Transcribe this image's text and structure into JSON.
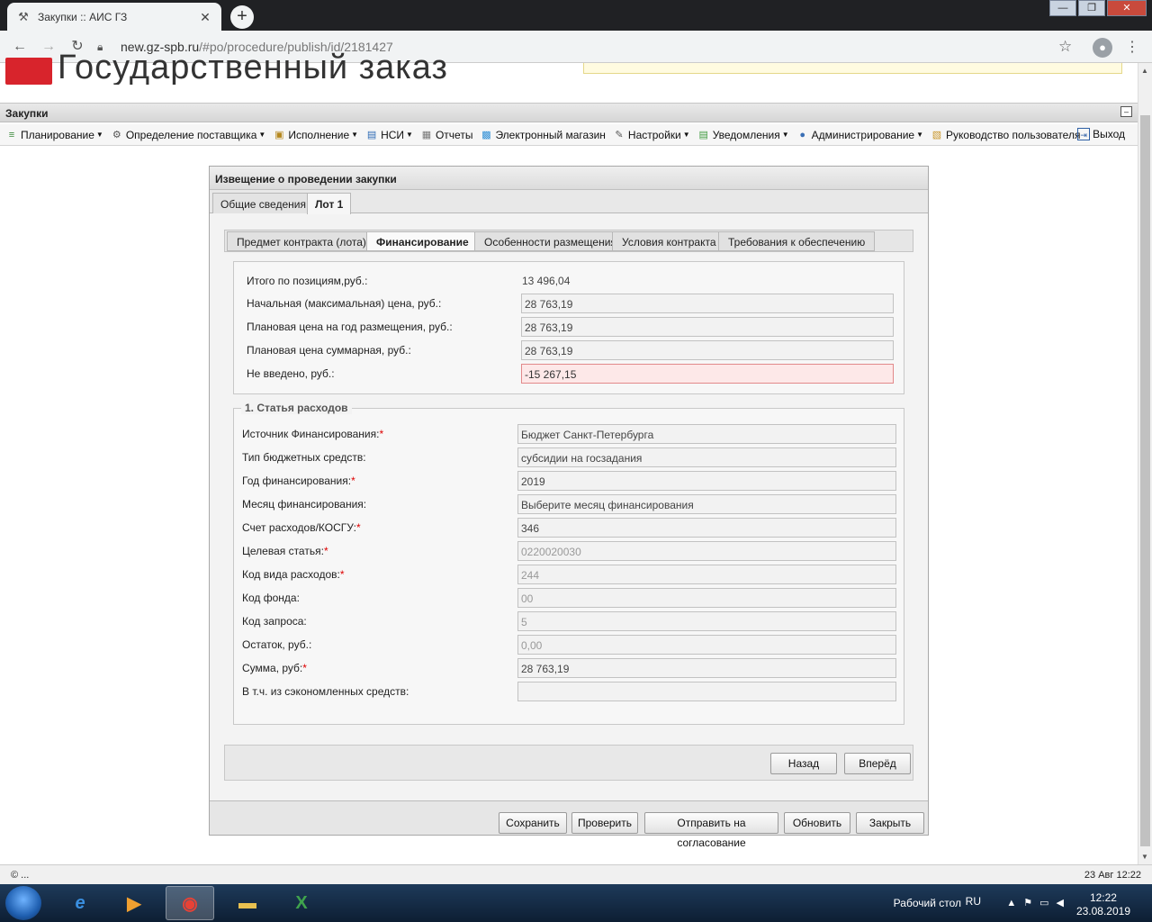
{
  "browser": {
    "tab_title": "Закупки :: АИС ГЗ",
    "tab_close": "✕",
    "newtab": "+",
    "win_min": "—",
    "win_max": "❐",
    "win_close": "✕",
    "url_host": "new.gz-spb.ru",
    "url_path": "/#po/procedure/publish/id/2181427"
  },
  "site": {
    "logo_text": "Государственный заказ"
  },
  "app": {
    "title": "Закупки",
    "minimize": "–"
  },
  "menu": {
    "items": [
      {
        "label": "Планирование",
        "icon": "planning-icon",
        "glyph": "≡",
        "color": "#3a8a3a"
      },
      {
        "label": "Определение поставщика",
        "icon": "gears-icon",
        "glyph": "⚙",
        "color": "#555"
      },
      {
        "label": "Исполнение",
        "icon": "execution-icon",
        "glyph": "▣",
        "color": "#b5871e"
      },
      {
        "label": "НСИ",
        "icon": "book-icon",
        "glyph": "▤",
        "color": "#2e6bb5"
      },
      {
        "label": "Отчеты",
        "icon": "report-icon",
        "glyph": "▦",
        "color": "#777"
      },
      {
        "label": "Электронный магазин",
        "icon": "cart-icon",
        "glyph": "▩",
        "color": "#2f8fd6"
      },
      {
        "label": "Настройки",
        "icon": "wrench-icon",
        "glyph": "✎",
        "color": "#555"
      },
      {
        "label": "Уведомления",
        "icon": "notification-icon",
        "glyph": "▤",
        "color": "#3f9b3f"
      },
      {
        "label": "Администрирование",
        "icon": "user-admin-icon",
        "glyph": "●",
        "color": "#3a6fb5"
      },
      {
        "label": "Руководство пользователя",
        "icon": "manual-icon",
        "glyph": "▧",
        "color": "#c9962a"
      }
    ],
    "dropdown_flags": [
      true,
      true,
      true,
      true,
      false,
      false,
      true,
      true,
      true,
      false
    ],
    "logout": "Выход"
  },
  "dialog": {
    "title": "Извещение о проведении закупки",
    "outer_tabs": [
      "Общие сведения",
      "Лот 1"
    ],
    "inner_tabs": [
      "Предмет контракта (лота)",
      "Финансирование",
      "Особенности размещения",
      "Условия контракта",
      "Требования к обеспечению"
    ],
    "summary": {
      "total_label": "Итого по позициям,руб.:",
      "total_value": "13 496,04",
      "nmc_label": "Начальная (максимальная) цена, руб.:",
      "nmc_value": "28 763,19",
      "plan_year_label": "Плановая цена на год размещения, руб.:",
      "plan_year_value": "28 763,19",
      "plan_sum_label": "Плановая цена суммарная, руб.:",
      "plan_sum_value": "28 763,19",
      "not_entered_label": "Не введено, руб.:",
      "not_entered_value": "-15 267,15"
    },
    "expense": {
      "legend": "1. Статья расходов",
      "fields": [
        {
          "label": "Источник Финансирования:",
          "required": true,
          "value": "Бюджет Санкт-Петербурга",
          "readonly": false
        },
        {
          "label": "Тип бюджетных средств:",
          "required": false,
          "value": "субсидии на госзадания",
          "readonly": false
        },
        {
          "label": "Год финансирования:",
          "required": true,
          "value": "2019",
          "readonly": false
        },
        {
          "label": "Месяц финансирования:",
          "required": false,
          "value": "Выберите месяц финансирования",
          "readonly": false
        },
        {
          "label": "Счет расходов/КОСГУ:",
          "required": true,
          "value": "346",
          "readonly": false
        },
        {
          "label": "Целевая статья:",
          "required": true,
          "value": "0220020030",
          "readonly": true
        },
        {
          "label": "Код вида расходов:",
          "required": true,
          "value": "244",
          "readonly": true
        },
        {
          "label": "Код фонда:",
          "required": false,
          "value": "00",
          "readonly": true
        },
        {
          "label": "Код запроса:",
          "required": false,
          "value": "5",
          "readonly": true
        },
        {
          "label": "Остаток, руб.:",
          "required": false,
          "value": "0,00",
          "readonly": true
        },
        {
          "label": "Сумма, руб:",
          "required": true,
          "value": "28 763,19",
          "readonly": false
        },
        {
          "label": "В т.ч. из сэкономленных средств:",
          "required": false,
          "value": "",
          "readonly": false
        }
      ]
    },
    "nav": {
      "back": "Назад",
      "forward": "Вперёд"
    },
    "footer": {
      "save": "Сохранить",
      "check": "Проверить",
      "send": "Отправить на согласование",
      "refresh": "Обновить",
      "close": "Закрыть"
    }
  },
  "status": {
    "left": "© ...",
    "right": "23 Авг 12:22"
  },
  "taskbar": {
    "desktop": "Рабочий стол",
    "lang": "RU",
    "time": "12:22",
    "date": "23.08.2019"
  }
}
